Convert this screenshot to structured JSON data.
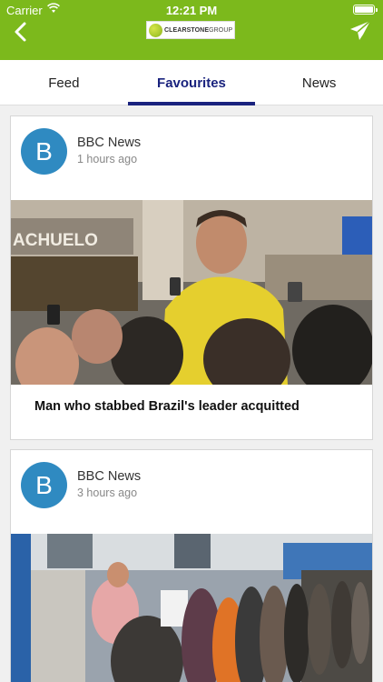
{
  "status_bar": {
    "carrier": "Carrier",
    "time": "12:21 PM"
  },
  "nav": {
    "logo_text": "CLEARSTONE",
    "logo_text_light": "GROUP"
  },
  "tabs": [
    {
      "label": "Feed",
      "active": false
    },
    {
      "label": "Favourites",
      "active": true
    },
    {
      "label": "News",
      "active": false
    }
  ],
  "colors": {
    "nav_green": "#7cb91c",
    "active_tab": "#1a237e",
    "avatar_blue": "#2f8ac1"
  },
  "posts": [
    {
      "avatar_letter": "B",
      "source": "BBC News",
      "time_ago": "1 hours ago",
      "headline": "Man who stabbed Brazil's leader acquitted",
      "image_sign": "ACHUELO"
    },
    {
      "avatar_letter": "B",
      "source": "BBC News",
      "time_ago": "3 hours ago"
    }
  ]
}
